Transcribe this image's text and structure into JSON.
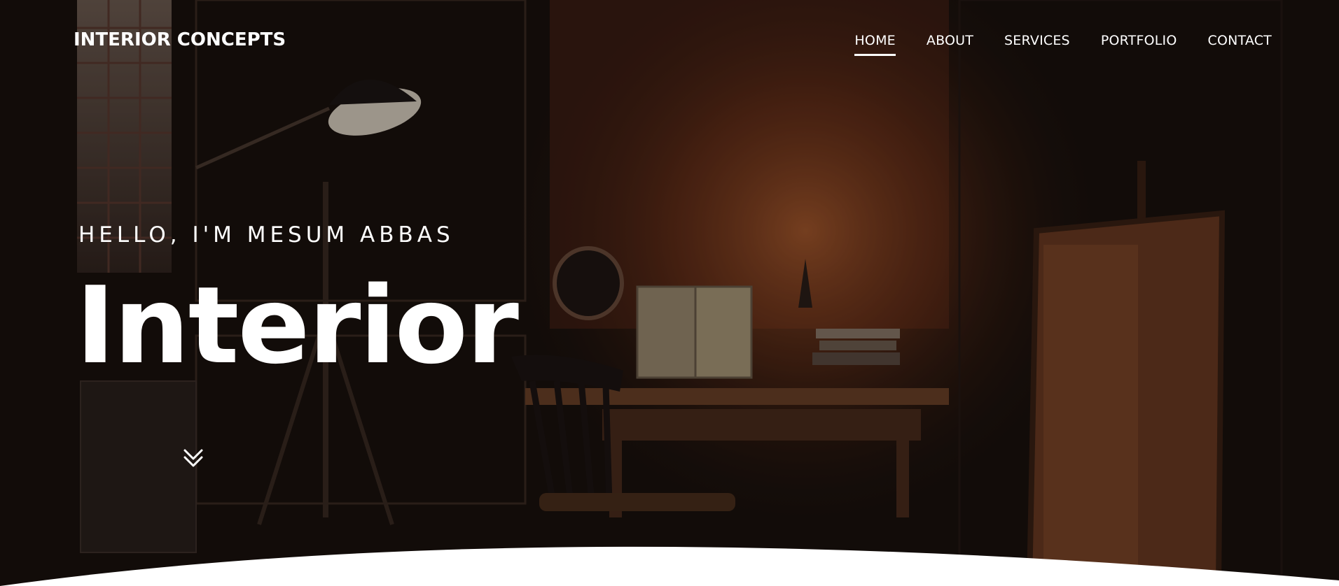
{
  "brand": {
    "name": "INTERIOR CONCEPTS"
  },
  "nav": {
    "items": [
      {
        "label": "HOME",
        "active": true
      },
      {
        "label": "ABOUT",
        "active": false
      },
      {
        "label": "SERVICES",
        "active": false
      },
      {
        "label": "PORTFOLIO",
        "active": false
      },
      {
        "label": "CONTACT",
        "active": false
      }
    ]
  },
  "hero": {
    "greeting": "HELLO, I'M MESUM ABBAS",
    "title": "Interior",
    "scroll_icon": "double-chevron-down-icon",
    "background": "dim-interior-studio-photo"
  },
  "colors": {
    "text": "#ffffff",
    "overlay": "#1a110d",
    "accent_warm": "#b85a2a",
    "page_bg": "#ffffff"
  }
}
